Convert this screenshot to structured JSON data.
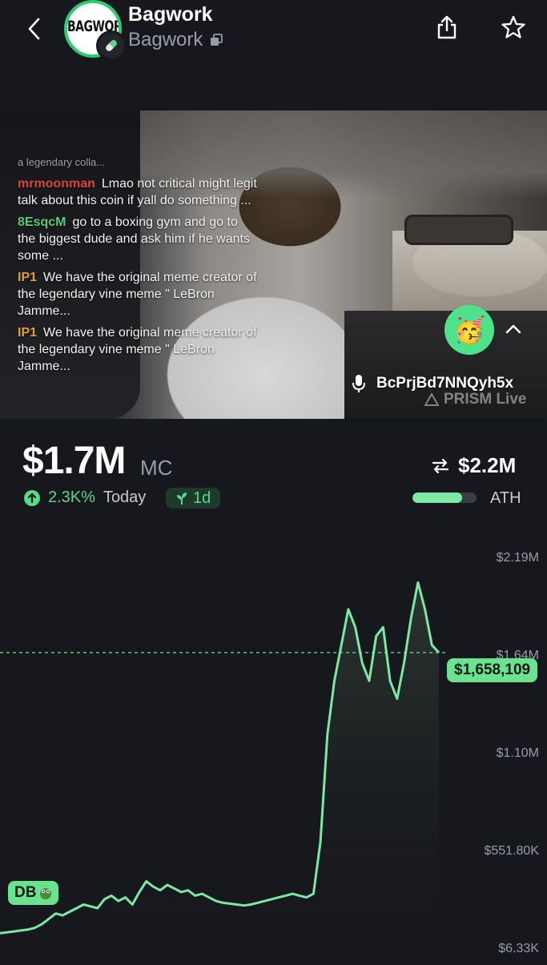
{
  "header": {
    "token_name": "Bagwork",
    "token_subtitle": "Bagwork",
    "logo_text": "BAGWORK"
  },
  "stream": {
    "chat": [
      {
        "user": "",
        "text": "a legendary colla...",
        "faded": true
      },
      {
        "user": "mrmoonman",
        "text": "Lmao not critical might legit talk about this coin if yall do something ...",
        "color": "#d9453f"
      },
      {
        "user": "8EsqcM",
        "text": "go to a boxing gym and go to the biggest dude and ask him if he wants some ...",
        "color": "#5cc97e"
      },
      {
        "user": "IP1",
        "text": "We have the original meme creator of the legendary vine meme \" LeBron Jamme...",
        "color": "#e2a23a"
      },
      {
        "user": "IP1",
        "text": "We have the original meme creator of the legendary vine meme \" LeBron Jamme...",
        "color": "#e2a23a"
      }
    ],
    "streamer_id": "BcPrjBd7NNQyh5x",
    "watermark": "PRISM Live",
    "reaction_emoji": "🥳"
  },
  "market": {
    "market_cap": "$1.7M",
    "mc_label": "MC",
    "change_pct": "2.3K%",
    "change_period": "Today",
    "age": "1d",
    "ath_value": "$2.2M",
    "ath_label": "ATH",
    "ath_progress": 0.77
  },
  "chart_data": {
    "type": "line",
    "y_ticks": [
      "$2.19M",
      "$1.64M",
      "$1.10M",
      "$551.80K",
      "$6.33K"
    ],
    "current_price_label": "$1,658,109",
    "current_value": 1658109,
    "start_marker": "DB",
    "ylim": [
      6330,
      2190000
    ],
    "values": [
      90000,
      95000,
      100000,
      105000,
      110000,
      120000,
      140000,
      170000,
      200000,
      190000,
      210000,
      230000,
      250000,
      240000,
      230000,
      280000,
      300000,
      270000,
      290000,
      250000,
      320000,
      380000,
      350000,
      330000,
      360000,
      340000,
      320000,
      330000,
      300000,
      310000,
      290000,
      270000,
      260000,
      255000,
      250000,
      245000,
      250000,
      260000,
      270000,
      280000,
      290000,
      300000,
      310000,
      300000,
      290000,
      310000,
      600000,
      1200000,
      1500000,
      1700000,
      1900000,
      1800000,
      1600000,
      1500000,
      1750000,
      1800000,
      1500000,
      1400000,
      1600000,
      1850000,
      2050000,
      1900000,
      1700000,
      1658109
    ]
  },
  "colors": {
    "background": "#17181d",
    "accent": "#6be28f",
    "line": "#7de8a3"
  }
}
